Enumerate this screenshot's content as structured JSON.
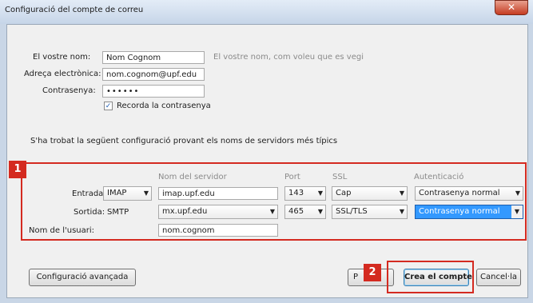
{
  "window": {
    "title": "Configuració del compte de correu",
    "close_glyph": "✕"
  },
  "identity": {
    "name_label": "El vostre nom:",
    "name_value": "Nom Cognom",
    "name_hint": "El vostre nom, com voleu que es vegi",
    "email_label": "Adreça electrònica:",
    "email_value": "nom.cognom@upf.edu",
    "password_label": "Contrasenya:",
    "password_mask": "••••••",
    "remember_checked": true,
    "remember_label": "Recorda la contrasenya"
  },
  "found_message": "S'ha trobat la següent configuració provant els noms de servidors més típics",
  "server_table": {
    "badge": "1",
    "headers": {
      "server": "Nom del servidor",
      "port": "Port",
      "ssl": "SSL",
      "auth": "Autenticació"
    },
    "incoming": {
      "label": "Entrada:",
      "protocol": "IMAP",
      "server": "imap.upf.edu",
      "port": "143",
      "ssl": "Cap",
      "auth": "Contrasenya normal"
    },
    "outgoing": {
      "label": "Sortida:",
      "protocol": "SMTP",
      "server": "mx.upf.edu",
      "port": "465",
      "ssl": "SSL/TLS",
      "auth": "Contrasenya normal"
    },
    "username_label": "Nom de l'usuari:",
    "username_value": "nom.cognom"
  },
  "buttons": {
    "advanced": "Configuració avançada",
    "retest_partial": "P",
    "badge": "2",
    "create": "Crea el compte",
    "cancel": "Cancel·la"
  },
  "colors": {
    "accent_red": "#d42a20",
    "selection_blue": "#3399ff"
  }
}
